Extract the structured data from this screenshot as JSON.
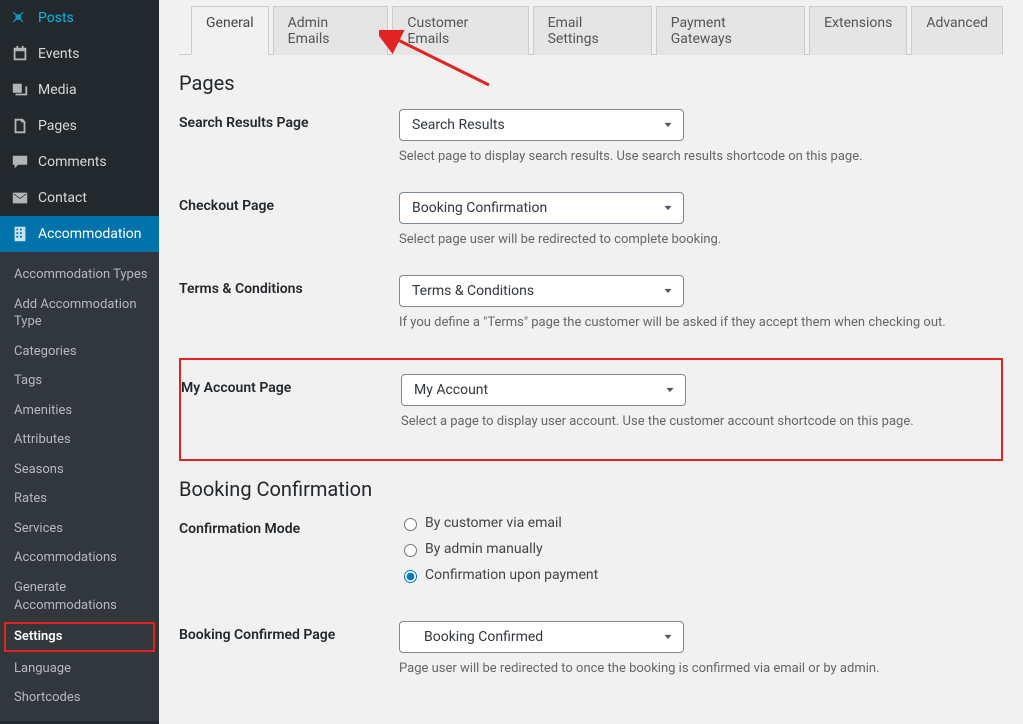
{
  "sidebar": {
    "main": [
      {
        "icon": "pin",
        "label": "Posts"
      },
      {
        "icon": "calendar",
        "label": "Events"
      },
      {
        "icon": "media",
        "label": "Media"
      },
      {
        "icon": "page",
        "label": "Pages"
      },
      {
        "icon": "comment",
        "label": "Comments"
      },
      {
        "icon": "mail",
        "label": "Contact"
      },
      {
        "icon": "building",
        "label": "Accommodation"
      }
    ],
    "sub": [
      {
        "label": "Accommodation Types"
      },
      {
        "label": "Add Accommodation Type"
      },
      {
        "label": "Categories"
      },
      {
        "label": "Tags"
      },
      {
        "label": "Amenities"
      },
      {
        "label": "Attributes"
      },
      {
        "label": "Seasons"
      },
      {
        "label": "Rates"
      },
      {
        "label": "Services"
      },
      {
        "label": "Accommodations"
      },
      {
        "label": "Generate Accommodations"
      },
      {
        "label": "Settings"
      },
      {
        "label": "Language"
      },
      {
        "label": "Shortcodes"
      }
    ]
  },
  "tabs": [
    "General",
    "Admin Emails",
    "Customer Emails",
    "Email Settings",
    "Payment Gateways",
    "Extensions",
    "Advanced"
  ],
  "sections": {
    "pages": {
      "title": "Pages",
      "search": {
        "label": "Search Results Page",
        "value": "Search Results",
        "help": "Select page to display search results. Use search results shortcode on this page."
      },
      "checkout": {
        "label": "Checkout Page",
        "value": "Booking Confirmation",
        "help": "Select page user will be redirected to complete booking."
      },
      "terms": {
        "label": "Terms & Conditions",
        "value": "Terms & Conditions",
        "help": "If you define a \"Terms\" page the customer will be asked if they accept them when checking out."
      },
      "account": {
        "label": "My Account Page",
        "value": "My Account",
        "help": "Select a page to display user account. Use the customer account shortcode on this page."
      }
    },
    "booking": {
      "title": "Booking Confirmation",
      "mode": {
        "label": "Confirmation Mode",
        "options": [
          "By customer via email",
          "By admin manually",
          "Confirmation upon payment"
        ]
      },
      "confirmed": {
        "label": "Booking Confirmed Page",
        "value": "Booking Confirmed",
        "help": "Page user will be redirected to once the booking is confirmed via email or by admin."
      }
    }
  }
}
